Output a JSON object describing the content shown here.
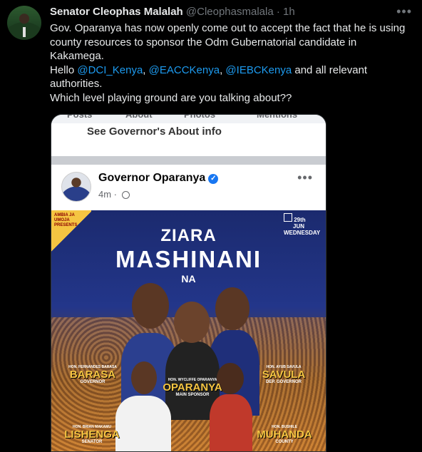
{
  "tweet": {
    "author_name": "Senator Cleophas Malalah",
    "handle": "@Cleophasmalala",
    "separator": "·",
    "time": "1h",
    "more": "•••",
    "line1": "Gov. Oparanya has now openly come out to accept the fact that he is using county resources to sponsor the Odm Gubernatorial candidate in Kakamega.",
    "hello": "Hello ",
    "mention1": "@DCI_Kenya",
    "comma1": ", ",
    "mention2": "@EACCKenya",
    "comma2": ", ",
    "mention3": "@IEBCKenya",
    "tail": " and all relevant authorities.",
    "line3": "Which level playing ground are you talking about??"
  },
  "embed": {
    "tabs": [
      "Posts",
      "About",
      "Photos",
      "Mentions"
    ],
    "see_about": "See Governor's About info",
    "post_author": "Governor Oparanya",
    "verified": "✓",
    "post_time": "4m",
    "more": "•••",
    "poster": {
      "brand": "AMBIA JA UMOJA PRESENTS",
      "date_day": "29th",
      "date_month": "JUN",
      "date_weekday": "WEDNESDAY",
      "title_line1": "ZIARA",
      "title_line2": "MASHINANI",
      "title_line3": "NA",
      "people": [
        {
          "hon": "HON. FERNANDES BARASA",
          "name": "BARASA",
          "role": "GOVERNOR"
        },
        {
          "hon": "HON. AYUB SAVULA",
          "name": "SAVULA",
          "role": "DEP. GOVERNOR"
        },
        {
          "hon": "HON. WYCLIFFE OPARANYA",
          "name": "OPARANYA",
          "role": "MAIN SPONSOR"
        },
        {
          "hon": "HON. BRIAN MAKAMU",
          "name": "LISHENGA",
          "role": "SENATOR"
        },
        {
          "hon": "HON. BUSHILE",
          "name": "MUHANDA",
          "role": "COUNTY"
        }
      ]
    }
  },
  "colors": {
    "link": "#1d9bf0",
    "muted": "#71767b",
    "text": "#e7e9ea",
    "fb_blue": "#1877f2"
  }
}
